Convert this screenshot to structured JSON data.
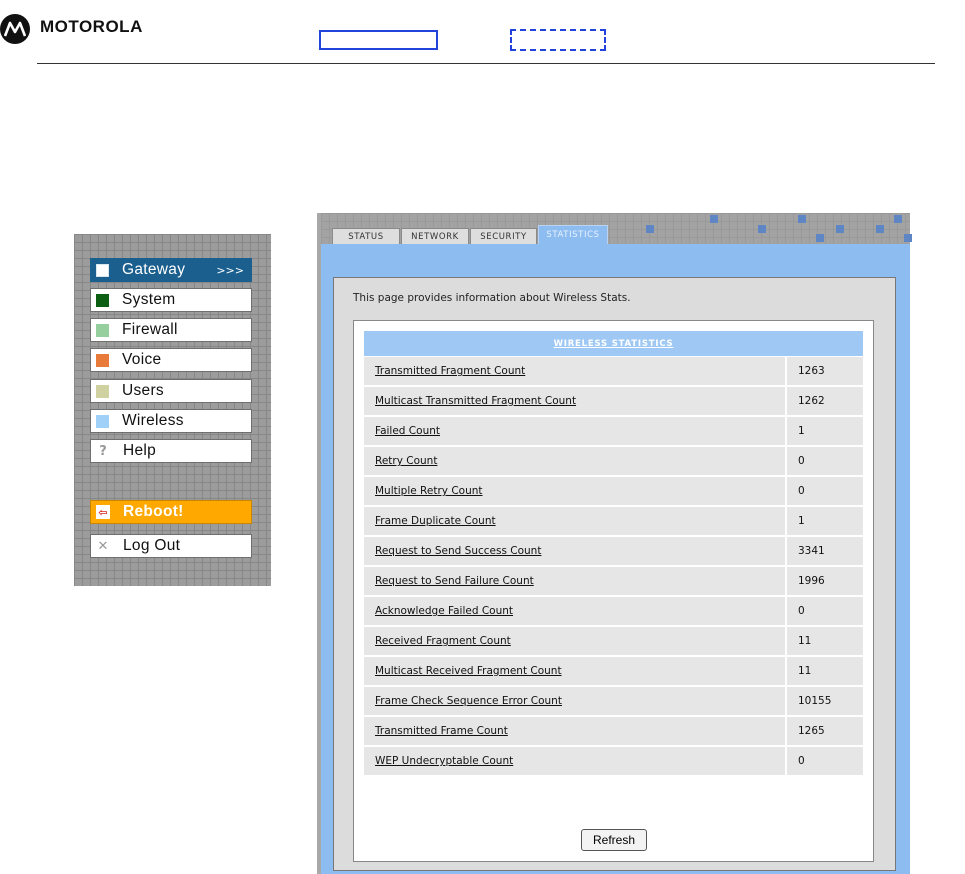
{
  "header": {
    "brand": "MOTOROLA"
  },
  "menu": {
    "items": [
      {
        "label": "Gateway",
        "arrows": ">>>",
        "color": "#ffffff"
      },
      {
        "label": "System",
        "color": "#0b5e12"
      },
      {
        "label": "Firewall",
        "color": "#96cf9e"
      },
      {
        "label": "Voice",
        "color": "#e87a3a"
      },
      {
        "label": "Users",
        "color": "#cfd1a0"
      },
      {
        "label": "Wireless",
        "color": "#9fd0f8"
      },
      {
        "label": "Help",
        "icon": "?"
      }
    ],
    "reboot": {
      "label": "Reboot!",
      "icon": "⇦"
    },
    "logout": {
      "label": "Log Out",
      "icon": "✕"
    }
  },
  "tabs": [
    {
      "label": "STATUS"
    },
    {
      "label": "NETWORK"
    },
    {
      "label": "SECURITY"
    },
    {
      "label": "STATISTICS",
      "active": true
    }
  ],
  "content": {
    "intro": "This page provides information about Wireless Stats.",
    "table_title": "WIRELESS STATISTICS",
    "rows": [
      {
        "name": "Transmitted Fragment Count",
        "value": "1263"
      },
      {
        "name": "Multicast Transmitted Fragment Count",
        "value": "1262"
      },
      {
        "name": "Failed Count",
        "value": "1"
      },
      {
        "name": "Retry Count",
        "value": "0"
      },
      {
        "name": "Multiple Retry Count",
        "value": "0"
      },
      {
        "name": "Frame Duplicate Count",
        "value": "1"
      },
      {
        "name": "Request to Send Success Count",
        "value": "3341"
      },
      {
        "name": "Request to Send Failure Count",
        "value": "1996"
      },
      {
        "name": "Acknowledge Failed Count",
        "value": "0"
      },
      {
        "name": "Received Fragment Count",
        "value": "11"
      },
      {
        "name": "Multicast Received Fragment Count",
        "value": "11"
      },
      {
        "name": "Frame Check Sequence Error Count",
        "value": "10155"
      },
      {
        "name": "Transmitted Frame Count",
        "value": "1265"
      },
      {
        "name": "WEP Undecryptable Count",
        "value": "0"
      }
    ],
    "refresh_label": "Refresh"
  }
}
